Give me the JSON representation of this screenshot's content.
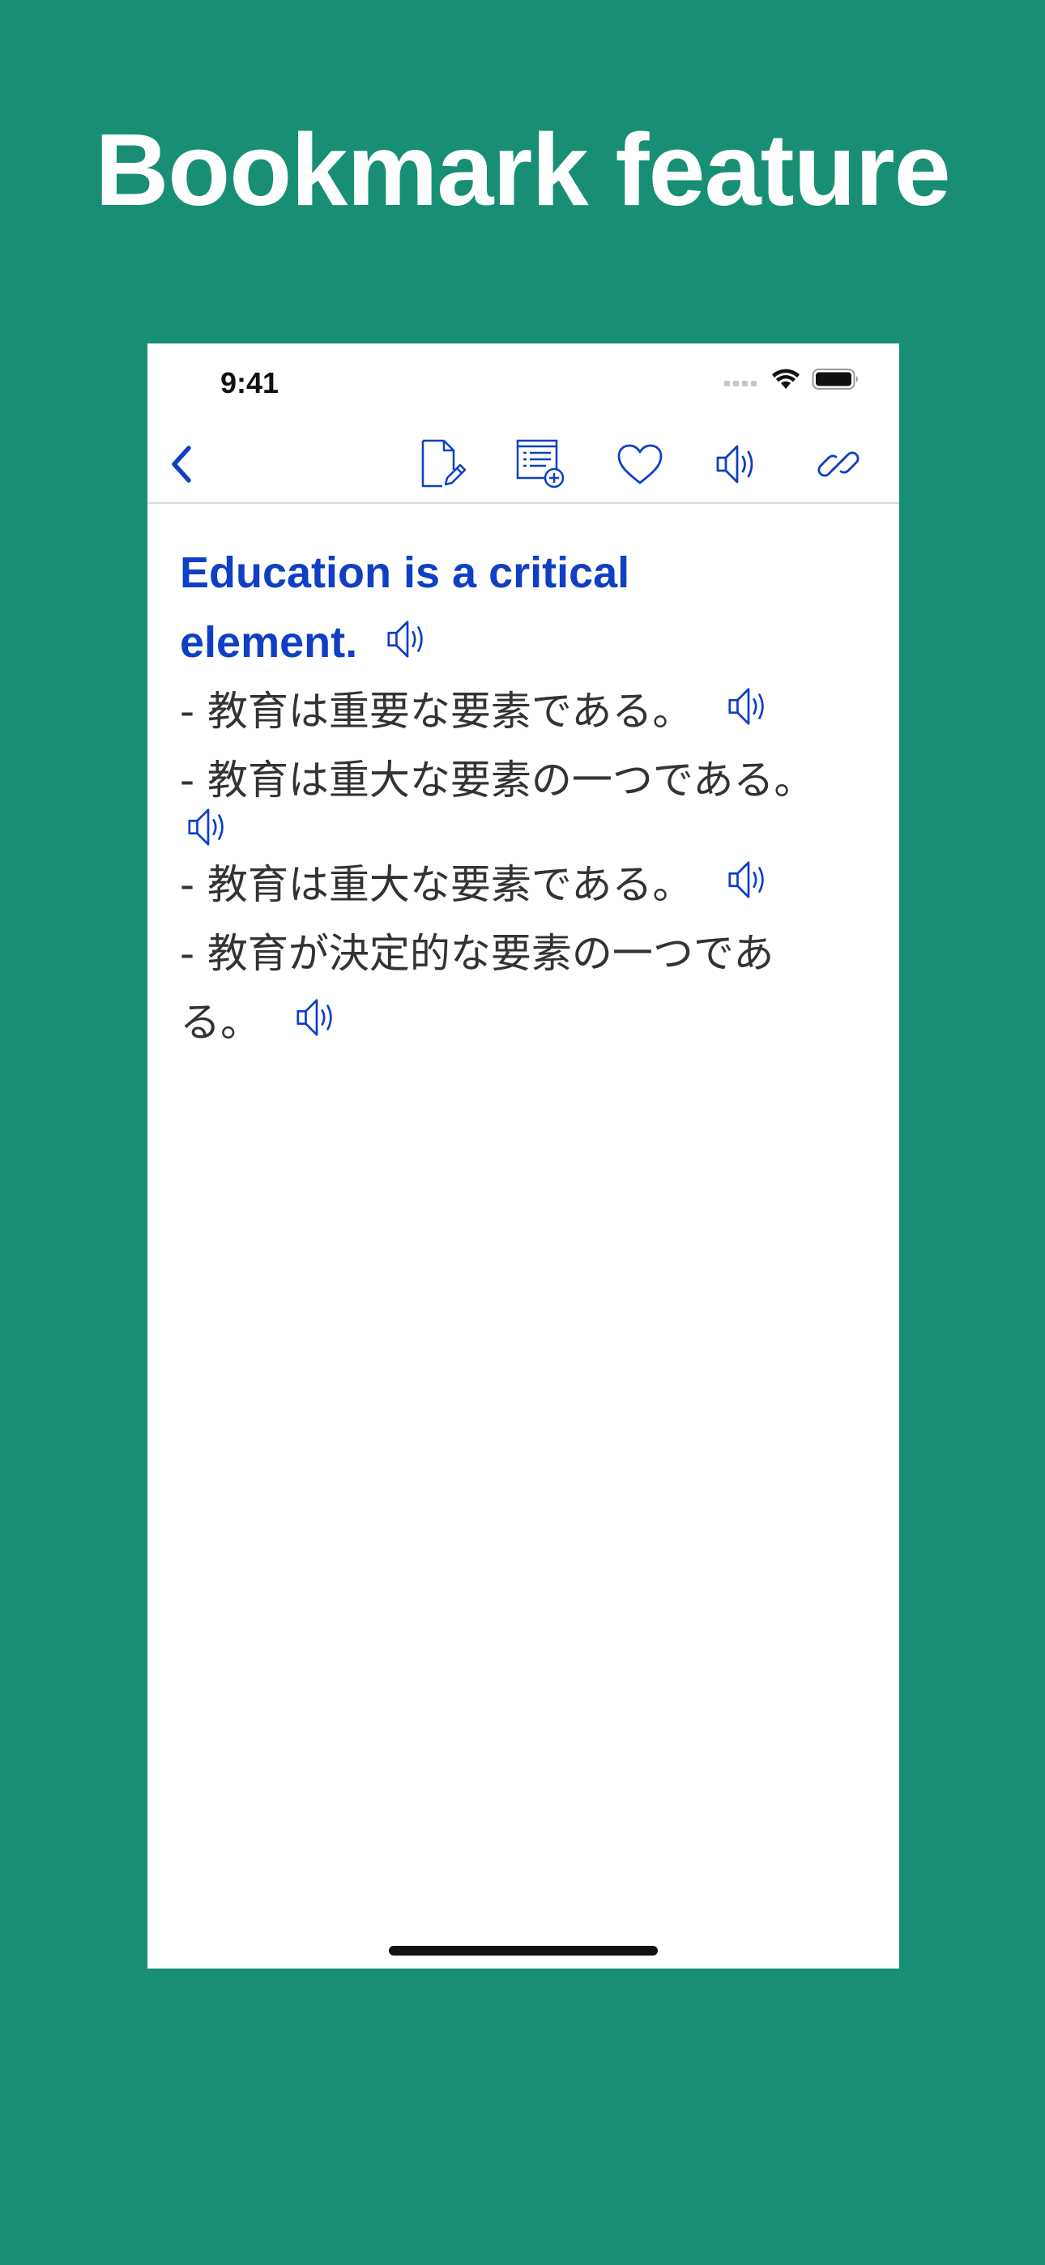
{
  "promo": {
    "title": "Bookmark feature"
  },
  "status_bar": {
    "time": "9:41"
  },
  "toolbar": {
    "icons": [
      "back-chevron-icon",
      "edit-note-icon",
      "add-to-list-icon",
      "heart-icon",
      "speaker-icon",
      "link-icon"
    ]
  },
  "entry": {
    "english": "Education is a critical element.",
    "translations": [
      "- 教育は重要な要素である。",
      "- 教育は重大な要素の一つである。",
      "- 教育は重大な要素である。",
      "- 教育が決定的な要素の一つである。"
    ]
  },
  "colors": {
    "background": "#188f74",
    "accent": "#0f3fc4",
    "text": "#333333"
  }
}
